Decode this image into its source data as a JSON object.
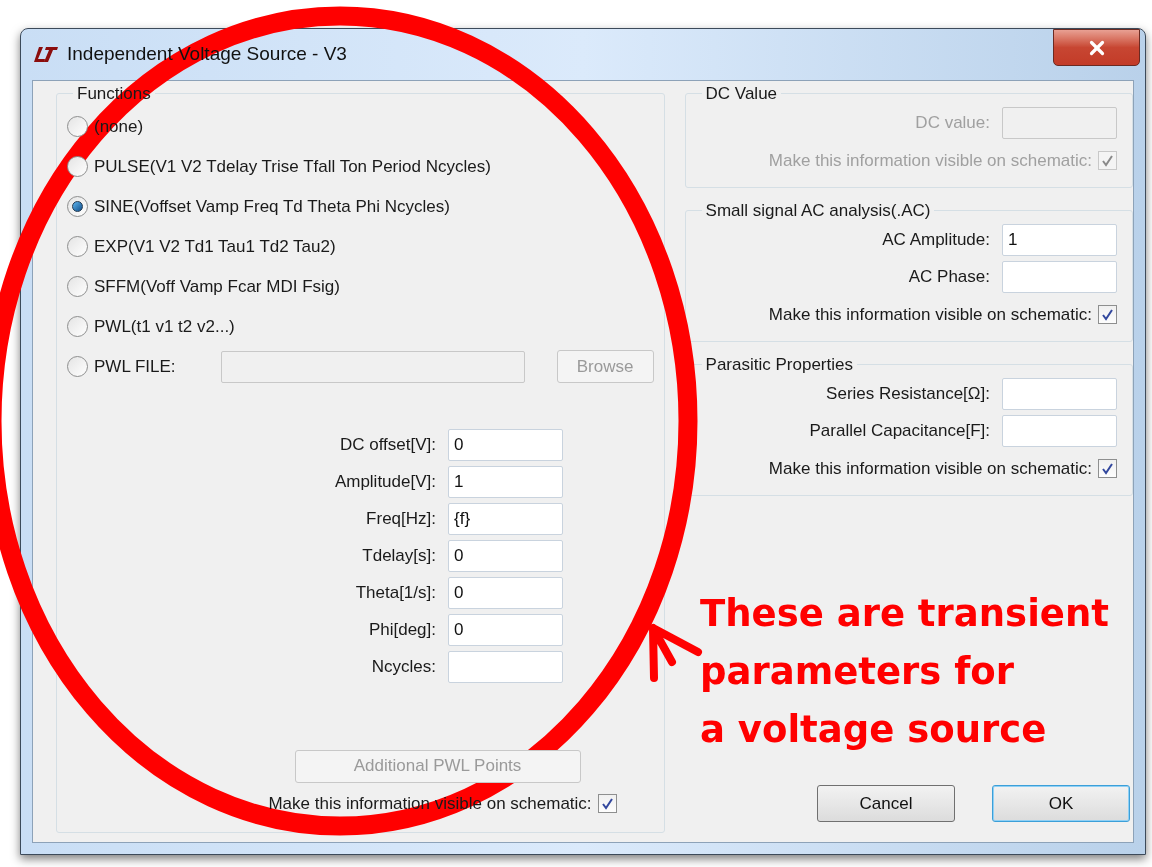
{
  "window": {
    "title": "Independent Voltage Source - V3"
  },
  "functions": {
    "title": "Functions",
    "options": [
      {
        "kind": "plain",
        "label": "(none)",
        "selected": false
      },
      {
        "kind": "plain",
        "label": "PULSE(V1 V2 Tdelay Trise Tfall Ton Period Ncycles)",
        "selected": false
      },
      {
        "kind": "plain",
        "label": "SINE(Voffset Vamp Freq Td Theta Phi Ncycles)",
        "selected": true
      },
      {
        "kind": "plain",
        "label": "EXP(V1 V2 Td1 Tau1 Td2 Tau2)",
        "selected": false
      },
      {
        "kind": "plain",
        "label": "SFFM(Voff Vamp Fcar MDI Fsig)",
        "selected": false
      },
      {
        "kind": "plain",
        "label": "PWL(t1 v1 t2 v2...)",
        "selected": false
      },
      {
        "kind": "file",
        "label": "PWL FILE:",
        "selected": false,
        "browse": "Browse",
        "disabled": true
      }
    ],
    "parameters": [
      {
        "label": "DC offset[V]:",
        "value": "0"
      },
      {
        "label": "Amplitude[V]:",
        "value": "1"
      },
      {
        "label": "Freq[Hz]:",
        "value": "{f}"
      },
      {
        "label": "Tdelay[s]:",
        "value": "0"
      },
      {
        "label": "Theta[1/s]:",
        "value": "0"
      },
      {
        "label": "Phi[deg]:",
        "value": "0"
      },
      {
        "label": "Ncycles:"
      }
    ],
    "additional_button": {
      "label": "Additional PWL Points",
      "disabled": true
    },
    "visible": {
      "label": "Make this information visible on schematic:",
      "checked": true,
      "disabled": false
    }
  },
  "groups": [
    {
      "title": "DC Value",
      "fields": [
        {
          "label": "DC value:",
          "disabled": true
        }
      ],
      "visible": {
        "label": "Make this information visible on schematic:",
        "checked": true,
        "disabled": true
      }
    },
    {
      "title": "Small signal AC analysis(.AC)",
      "fields": [
        {
          "label": "AC Amplitude:",
          "value": "1",
          "disabled": false
        },
        {
          "label": "AC Phase:",
          "disabled": false
        }
      ],
      "visible": {
        "label": "Make this information visible on schematic:",
        "checked": true,
        "disabled": false
      }
    },
    {
      "title": "Parasitic Properties",
      "fields": [
        {
          "label": "Series Resistance[Ω]:",
          "disabled": false
        },
        {
          "label": "Parallel Capacitance[F]:",
          "disabled": false
        }
      ],
      "visible": {
        "label": "Make this information visible on schematic:",
        "checked": true,
        "disabled": false
      }
    }
  ],
  "buttons": [
    {
      "label": "Cancel",
      "default": false
    },
    {
      "label": "OK",
      "default": true
    }
  ],
  "annotation": {
    "lines": [
      "These are transient",
      "parameters for",
      "a voltage source"
    ]
  }
}
